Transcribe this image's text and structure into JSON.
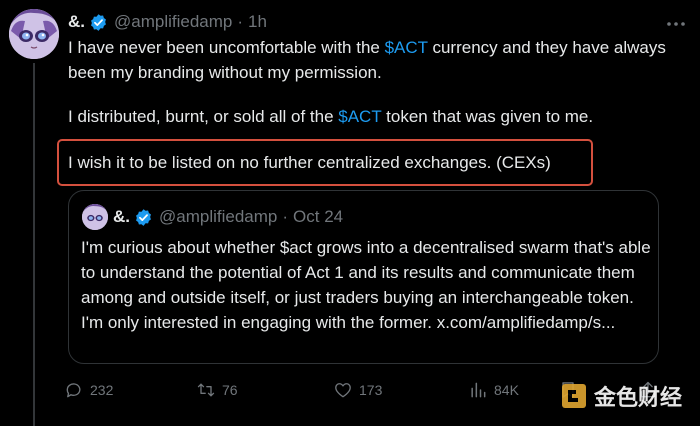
{
  "tweet": {
    "author_name": "&.",
    "handle": "@amplifiedamp",
    "separator": "·",
    "time": "1h",
    "paragraph1_before": "I have never been uncomfortable with the ",
    "paragraph1_cashtag": "$ACT",
    "paragraph1_after": " currency and they have always been my branding without my permission.",
    "paragraph2_before": "I distributed, burnt, or sold all of the ",
    "paragraph2_cashtag": "$ACT",
    "paragraph2_after": " token that was given to me.",
    "paragraph3": "I wish it to be listed on no further centralized exchanges. (CEXs)"
  },
  "quote": {
    "author_name": "&.",
    "handle": "@amplifiedamp",
    "separator": "·",
    "time": "Oct 24",
    "text": "I'm curious about whether $act grows into a decentralised swarm that's able to understand the potential of Act 1 and its results and communicate them among and outside itself, or just traders buying an interchangeable token. I'm only interested in engaging with the former. x.com/amplifiedamp/s..."
  },
  "actions": {
    "replies": "232",
    "reposts": "76",
    "likes": "173",
    "views": "84K"
  },
  "watermark": {
    "text": "金色财经"
  },
  "colors": {
    "background": "#000000",
    "text": "#e7e9ea",
    "muted": "#71767b",
    "link": "#1d9bf0",
    "highlight": "#d4503e",
    "verified": "#1d9bf0"
  },
  "icons": [
    "more-icon",
    "verified-icon",
    "reply-icon",
    "repost-icon",
    "like-icon",
    "views-icon",
    "bookmark-icon",
    "share-icon",
    "watermark-logo-icon"
  ]
}
